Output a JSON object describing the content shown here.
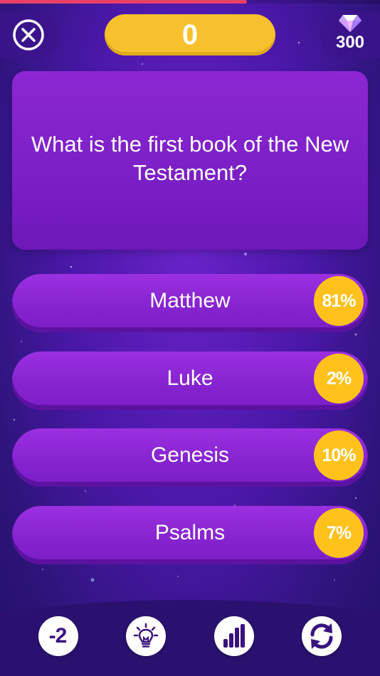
{
  "timer": {
    "progress": 0.65,
    "color": "#e94067"
  },
  "header": {
    "close_icon": "close-circle-icon",
    "score": "0",
    "gems": {
      "icon": "diamond-icon",
      "count": "300"
    }
  },
  "question": {
    "text": "What is the first book of the New Testament?"
  },
  "answers": [
    {
      "label": "Matthew",
      "percent": "81%"
    },
    {
      "label": "Luke",
      "percent": "2%"
    },
    {
      "label": "Genesis",
      "percent": "10%"
    },
    {
      "label": "Psalms",
      "percent": "7%"
    }
  ],
  "lifelines": [
    {
      "name": "fifty-fifty",
      "label": "-2",
      "icon": "minus-two-icon"
    },
    {
      "name": "hint",
      "icon": "lightbulb-icon"
    },
    {
      "name": "audience-poll",
      "icon": "bar-chart-icon"
    },
    {
      "name": "swap-question",
      "icon": "refresh-icon"
    }
  ],
  "colors": {
    "accent_yellow": "#f7c12e",
    "percent_badge": "#ffc21c",
    "answer_purple": "#8624d0",
    "background_purple": "#4a18a8"
  }
}
